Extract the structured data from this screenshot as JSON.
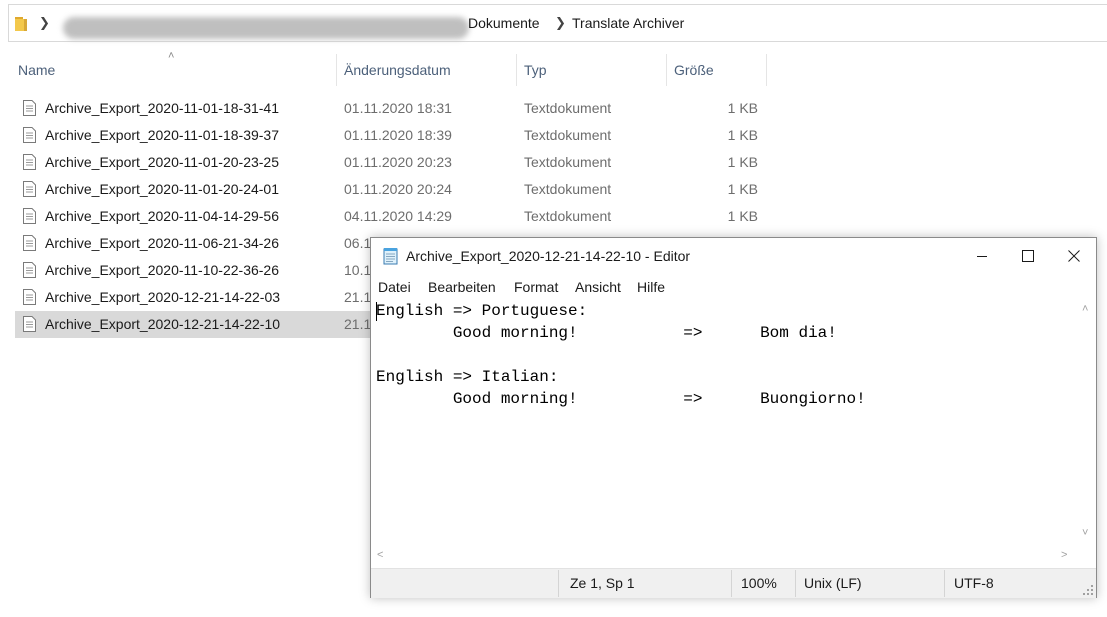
{
  "explorer": {
    "breadcrumb": [
      "Dokumente",
      "Translate Archiver"
    ],
    "columns": {
      "name": "Name",
      "modified": "Änderungsdatum",
      "type": "Typ",
      "size": "Größe"
    },
    "files": [
      {
        "name": "Archive_Export_2020-11-01-18-31-41",
        "date": "01.11.2020 18:31",
        "type": "Textdokument",
        "size": "1 KB"
      },
      {
        "name": "Archive_Export_2020-11-01-18-39-37",
        "date": "01.11.2020 18:39",
        "type": "Textdokument",
        "size": "1 KB"
      },
      {
        "name": "Archive_Export_2020-11-01-20-23-25",
        "date": "01.11.2020 20:23",
        "type": "Textdokument",
        "size": "1 KB"
      },
      {
        "name": "Archive_Export_2020-11-01-20-24-01",
        "date": "01.11.2020 20:24",
        "type": "Textdokument",
        "size": "1 KB"
      },
      {
        "name": "Archive_Export_2020-11-04-14-29-56",
        "date": "04.11.2020 14:29",
        "type": "Textdokument",
        "size": "1 KB"
      },
      {
        "name": "Archive_Export_2020-11-06-21-34-26",
        "date": "06.1"
      },
      {
        "name": "Archive_Export_2020-11-10-22-36-26",
        "date": "10.1"
      },
      {
        "name": "Archive_Export_2020-12-21-14-22-03",
        "date": "21.1"
      },
      {
        "name": "Archive_Export_2020-12-21-14-22-10",
        "date": "21.1",
        "selected": true
      }
    ]
  },
  "notepad": {
    "title": "Archive_Export_2020-12-21-14-22-10 - Editor",
    "menu": [
      "Datei",
      "Bearbeiten",
      "Format",
      "Ansicht",
      "Hilfe"
    ],
    "lines": [
      "English => Portuguese:",
      "        Good morning!           =>      Bom dia!",
      "",
      "English => Italian:",
      "        Good morning!           =>      Buongiorno!"
    ],
    "status": {
      "position": "Ze 1, Sp 1",
      "zoom": "100%",
      "line_ending": "Unix (LF)",
      "encoding": "UTF-8"
    }
  },
  "colors": {
    "selected_row": "#d9d9d9",
    "header_text": "#4c607a",
    "detail_text": "#6d6d6d",
    "folder_yellow": "#f3c84b"
  },
  "icons": [
    "folder-icon",
    "chevron-right-icon",
    "sort-ascending-icon",
    "text-file-icon",
    "notepad-icon",
    "minimize-icon",
    "maximize-icon",
    "close-icon"
  ]
}
